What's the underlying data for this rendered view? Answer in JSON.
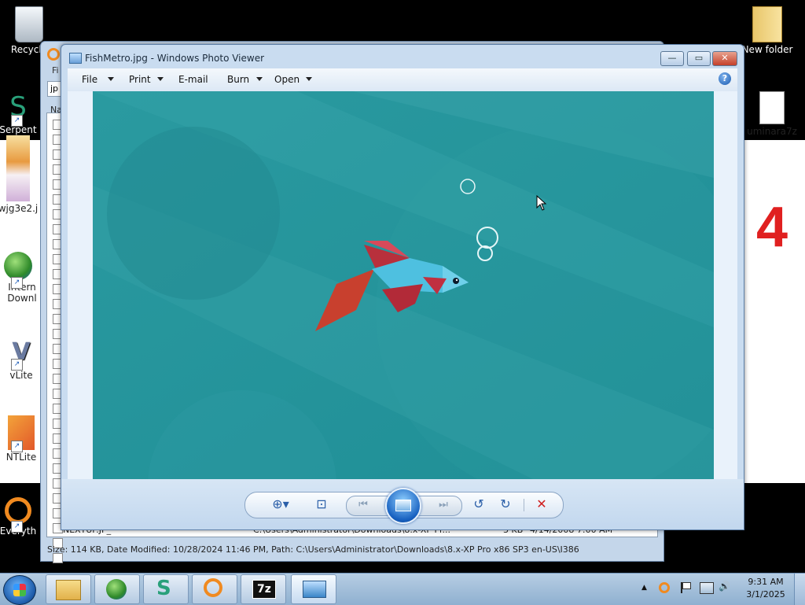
{
  "desktop": {
    "icons": [
      {
        "label": "Recycle",
        "name": "recycle-bin-icon"
      },
      {
        "label": "Serpent",
        "name": "serpent-icon"
      },
      {
        "label": "wjg3e2.j",
        "name": "image-file-icon"
      },
      {
        "label": "Intern Downl",
        "name": "internet-download-manager-icon"
      },
      {
        "label": "vLite",
        "name": "vlite-icon"
      },
      {
        "label": "NTLite",
        "name": "ntlite-icon"
      },
      {
        "label": "Everyth",
        "name": "everything-search-icon"
      },
      {
        "label": "New folder",
        "name": "folder-icon"
      },
      {
        "label": "uminara7z",
        "name": "file-icon"
      }
    ],
    "big_number": "4"
  },
  "search_window": {
    "column_header": "Na",
    "fields": [
      "Fi",
      "jp"
    ],
    "visible_row": {
      "name": "NEXTUP.JP_",
      "path": "C:\\Users\\Administrator\\Downloads\\8.x-XP Pr...",
      "size": "3 KB",
      "modified": "4/14/2008 7:00 AM"
    },
    "status": "Size: 114 KB, Date Modified: 10/28/2024 11:46 PM, Path: C:\\Users\\Administrator\\Downloads\\8.x-XP Pro x86 SP3 en-US\\I386"
  },
  "photo_viewer": {
    "title": "FishMetro.jpg - Windows Photo Viewer",
    "window_controls": {
      "minimize": "—",
      "maximize": "▭",
      "close": "✕"
    },
    "menu": [
      {
        "label": "File",
        "dropdown": true
      },
      {
        "label": "Print",
        "dropdown": true
      },
      {
        "label": "E-mail",
        "dropdown": false
      },
      {
        "label": "Burn",
        "dropdown": true
      },
      {
        "label": "Open",
        "dropdown": true
      }
    ],
    "help": "?",
    "toolbar": {
      "zoom": "⊕▾",
      "fit": "⊡",
      "previous": "⏮",
      "next": "⏭",
      "rotate_ccw": "↺",
      "rotate_cw": "↻",
      "delete": "✕"
    },
    "colors": {
      "water": "#2b9aa0",
      "fish_body": "#4ec0e0",
      "fish_fins": "#c03040",
      "fish_tail": "#d84a34"
    }
  },
  "taskbar": {
    "pinned": [
      {
        "name": "explorer-icon"
      },
      {
        "name": "internet-download-manager-icon"
      },
      {
        "name": "serpent-icon"
      },
      {
        "name": "search-icon"
      },
      {
        "name": "7zip-icon",
        "label": "7z"
      },
      {
        "name": "photo-viewer-icon"
      }
    ],
    "tray": {
      "expand": "▲",
      "speaker": "🔊"
    },
    "time": "9:31 AM",
    "date": "3/1/2025"
  }
}
